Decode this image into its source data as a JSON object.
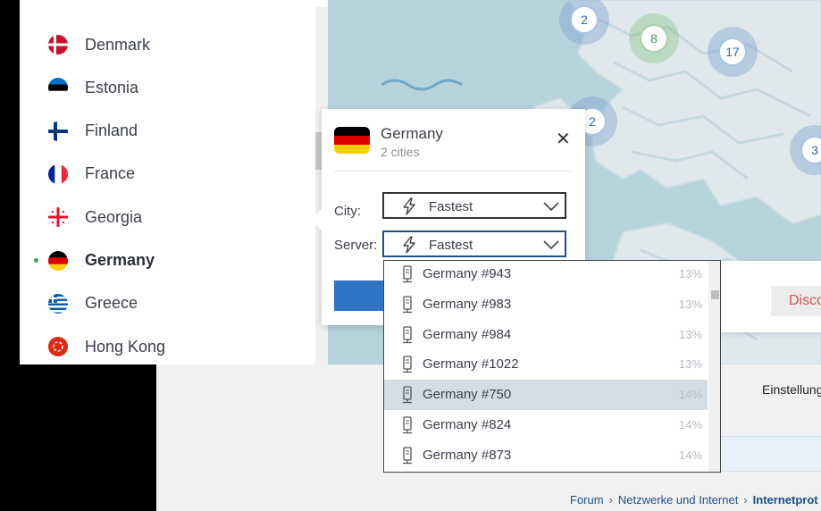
{
  "sidebar": {
    "countries": [
      {
        "name": "Denmark",
        "flag": "dk",
        "active": false
      },
      {
        "name": "Estonia",
        "flag": "ee",
        "active": false
      },
      {
        "name": "Finland",
        "flag": "fi",
        "active": false
      },
      {
        "name": "France",
        "flag": "fr",
        "active": false
      },
      {
        "name": "Georgia",
        "flag": "ge",
        "active": false
      },
      {
        "name": "Germany",
        "flag": "de",
        "active": true
      },
      {
        "name": "Greece",
        "flag": "gr",
        "active": false
      },
      {
        "name": "Hong Kong",
        "flag": "hk",
        "active": false
      }
    ]
  },
  "map": {
    "clusters": [
      {
        "label": "2",
        "color": "#2a6db5"
      },
      {
        "label": "8",
        "color": "#3aa45a"
      },
      {
        "label": "17",
        "color": "#2a6db5"
      },
      {
        "label": "2",
        "color": "#2a6db5"
      },
      {
        "label": "3",
        "color": "#2a6db5"
      }
    ]
  },
  "popup": {
    "title": "Germany",
    "subtitle": "2 cities",
    "close_icon": "close-icon",
    "city_label": "City:",
    "city_value": "Fastest",
    "server_label": "Server:",
    "server_value": "Fastest"
  },
  "servers": [
    {
      "name": "Germany #943",
      "load": "13%",
      "highlighted": false
    },
    {
      "name": "Germany #983",
      "load": "13%",
      "highlighted": false
    },
    {
      "name": "Germany #984",
      "load": "13%",
      "highlighted": false
    },
    {
      "name": "Germany #1022",
      "load": "13%",
      "highlighted": false
    },
    {
      "name": "Germany #750",
      "load": "14%",
      "highlighted": true
    },
    {
      "name": "Germany #824",
      "load": "14%",
      "highlighted": false
    },
    {
      "name": "Germany #873",
      "load": "14%",
      "highlighted": false
    }
  ],
  "side_panel": {
    "disconnect_label": "Disco"
  },
  "background_page": {
    "settings_label": "Einstellung",
    "breadcrumb": [
      "Forum",
      "Netzwerke und Internet",
      "Internetprot"
    ]
  },
  "colors": {
    "accent": "#2e75c8",
    "active_dot": "#3aa45a",
    "highlight": "#d4dde6"
  }
}
